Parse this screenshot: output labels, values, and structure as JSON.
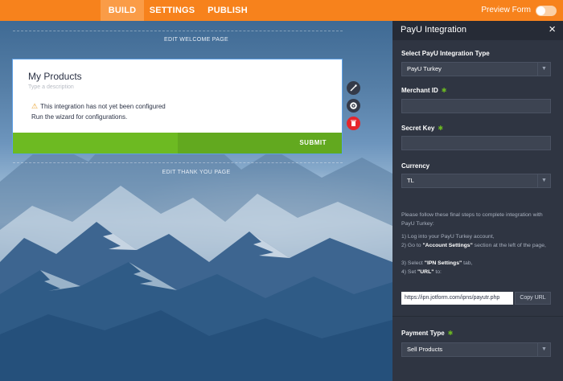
{
  "topbar": {
    "tabs": [
      "BUILD",
      "SETTINGS",
      "PUBLISH"
    ],
    "active_tab": "BUILD",
    "preview_label": "Preview Form"
  },
  "canvas": {
    "edit_welcome": "EDIT WELCOME PAGE",
    "edit_thankyou": "EDIT THANK YOU PAGE",
    "card": {
      "title": "My Products",
      "description_placeholder": "Type a description",
      "warning": "This integration has not yet been configured",
      "wizard_note": "Run the wizard for configurations.",
      "submit_label": "SUBMIT"
    }
  },
  "panel": {
    "title": "PayU Integration",
    "integration_type_label": "Select PayU Integration Type",
    "integration_type_value": "PayU Turkey",
    "merchant_id_label": "Merchant ID",
    "secret_key_label": "Secret Key",
    "currency_label": "Currency",
    "currency_value": "TL",
    "instructions_intro": "Please follow these final steps to complete integration with PayU Turkey:",
    "step1": "1)  Log into your PayU Turkey account,",
    "step2_pre": "2)  Go to ",
    "step2_bold": "\"Account Settings\"",
    "step2_post": " section at the left of the page,",
    "step3_pre": "3)  Select ",
    "step3_bold": "\"IPN Settings\"",
    "step3_post": " tab,",
    "step4_pre": "4)  Set ",
    "step4_bold": "\"URL\"",
    "step4_post": " to:",
    "url_value": "https://ipn.jotform.com/ipns/payutr.php",
    "copy_label": "Copy URL",
    "payment_type_label": "Payment Type",
    "payment_type_value": "Sell Products"
  },
  "colors": {
    "brand_orange": "#f7821c",
    "submit_green": "#6dba22",
    "panel_bg": "#2f3542",
    "delete_red": "#e5262c"
  }
}
